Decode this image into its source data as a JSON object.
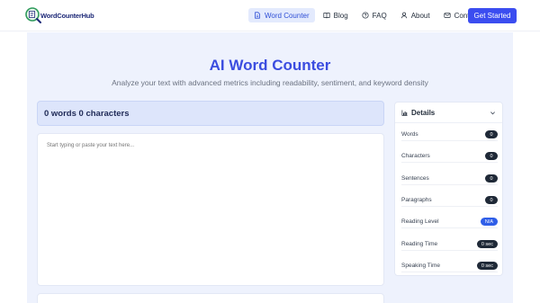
{
  "header": {
    "logo_text": "WordCounterHub",
    "nav": [
      {
        "label": "Word Counter",
        "icon": "document-icon",
        "active": true
      },
      {
        "label": "Blog",
        "icon": "book-icon",
        "active": false
      },
      {
        "label": "FAQ",
        "icon": "question-icon",
        "active": false
      },
      {
        "label": "About",
        "icon": "user-icon",
        "active": false
      },
      {
        "label": "Contact",
        "icon": "mail-icon",
        "active": false
      }
    ],
    "cta": "Get Started"
  },
  "main": {
    "title": "AI Word Counter",
    "subtitle": "Analyze your text with advanced metrics including readability, sentiment, and keyword density",
    "counter": "0 words 0 characters",
    "placeholder": "Start typing or paste your text here..."
  },
  "details": {
    "title": "Details",
    "rows": [
      {
        "label": "Words",
        "value": "0"
      },
      {
        "label": "Characters",
        "value": "0"
      },
      {
        "label": "Sentences",
        "value": "0"
      },
      {
        "label": "Paragraphs",
        "value": "0"
      },
      {
        "label": "Reading Level",
        "value": "N/A"
      },
      {
        "label": "Reading Time",
        "value": "0 sec"
      },
      {
        "label": "Speaking Time",
        "value": "0 sec"
      }
    ]
  },
  "colors": {
    "accent": "#3b4df0",
    "title": "#3b4de0",
    "panel_bg": "#eef2fd"
  }
}
